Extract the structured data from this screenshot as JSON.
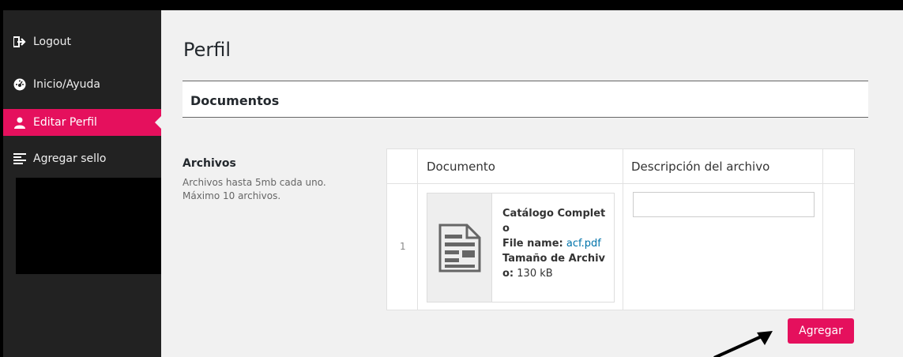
{
  "sidebar": {
    "items": [
      {
        "label": "Logout",
        "icon": "logout-icon"
      },
      {
        "label": "Inicio/Ayuda",
        "icon": "dashboard-icon"
      },
      {
        "label": "Editar Perfil",
        "icon": "user-icon",
        "active": true
      },
      {
        "label": "Agregar sello",
        "icon": "list-icon"
      }
    ]
  },
  "page": {
    "title": "Perfil"
  },
  "section": {
    "title": "Documentos"
  },
  "field": {
    "label": "Archivos",
    "description": "Archivos hasta 5mb cada uno. Máximo 10 archivos."
  },
  "table": {
    "headers": [
      "Documento",
      "Descripción del archivo"
    ],
    "rows": [
      {
        "index": "1",
        "doc_title": "Catálogo Completo",
        "file_name_label": "File name:",
        "file_name": "acf.pdf",
        "size_label": "Tamaño de Archivo:",
        "size": "130 kB",
        "description_value": ""
      }
    ]
  },
  "actions": {
    "add_label": "Agregar"
  },
  "colors": {
    "accent": "#e5105d",
    "sidebar_bg": "#222222",
    "link": "#0073aa"
  }
}
